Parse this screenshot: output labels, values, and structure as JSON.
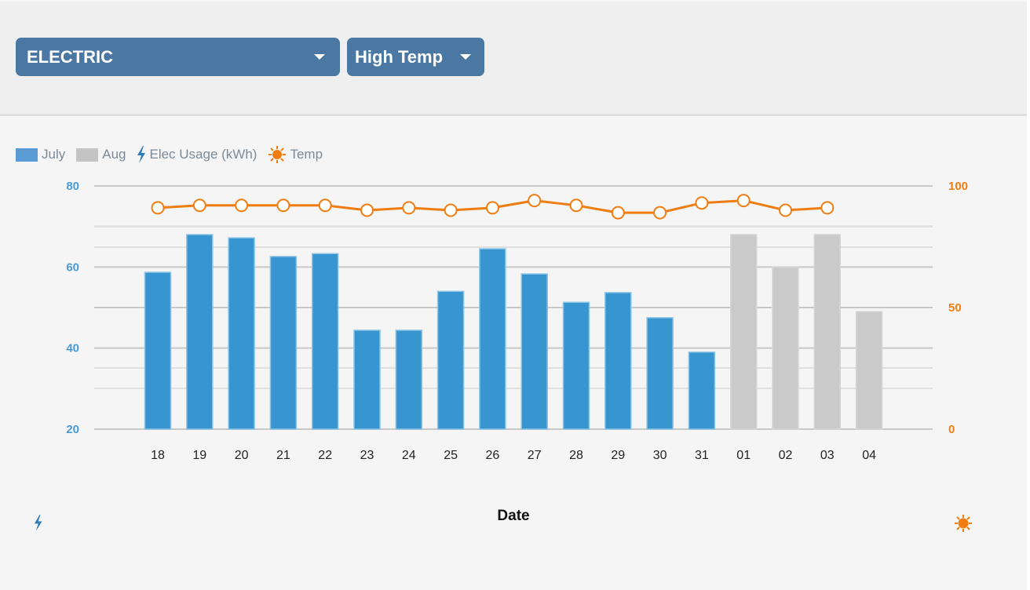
{
  "controls": {
    "utility_select": {
      "value": "ELECTRIC"
    },
    "metric_select": {
      "value": "High Temp"
    }
  },
  "legend": [
    {
      "label": "July",
      "kind": "swatch",
      "color": "#5b9bd5"
    },
    {
      "label": "Aug",
      "kind": "swatch",
      "color": "#c4c4c4"
    },
    {
      "label": "Elec Usage (kWh)",
      "kind": "bolt-icon",
      "color": "#2e7ab4"
    },
    {
      "label": "Temp",
      "kind": "sun-icon",
      "color": "#ef7d12"
    }
  ],
  "colors": {
    "july_bar": "#3796d0",
    "aug_bar": "#cacaca",
    "temp_line": "#ef7d12",
    "left_axis": "#4b9ad6",
    "right_axis": "#ef7d12",
    "grid_major": "#c8c8c8",
    "grid_minor": "#e0e0e0"
  },
  "chart_data": {
    "type": "bar",
    "title": "",
    "xlabel": "Date",
    "ylabel_left_icon": "bolt-icon",
    "ylabel_right_icon": "sun-icon",
    "categories": [
      "18",
      "19",
      "20",
      "21",
      "22",
      "23",
      "24",
      "25",
      "26",
      "27",
      "28",
      "29",
      "30",
      "31",
      "01",
      "02",
      "03",
      "04"
    ],
    "series": [
      {
        "name": "Elec Usage (kWh)",
        "type": "bar",
        "axis": "left",
        "month_groups": [
          "July",
          "July",
          "July",
          "July",
          "July",
          "July",
          "July",
          "July",
          "July",
          "July",
          "July",
          "July",
          "July",
          "July",
          "Aug",
          "Aug",
          "Aug",
          "Aug"
        ],
        "values": [
          58.7,
          68,
          67.2,
          62.6,
          63.3,
          44.4,
          44.4,
          54,
          64.5,
          58.3,
          51.3,
          53.7,
          47.5,
          39,
          68,
          60,
          68,
          49
        ]
      },
      {
        "name": "Temp",
        "type": "line",
        "axis": "right",
        "values": [
          91,
          92,
          92,
          92,
          92,
          90,
          91,
          90,
          91,
          94,
          92,
          89,
          89,
          93,
          94,
          90,
          91,
          null
        ]
      }
    ],
    "y_left": {
      "min": 20,
      "max": 80,
      "ticks": [
        20,
        40,
        60,
        80
      ]
    },
    "y_right": {
      "min": 0,
      "max": 100,
      "ticks": [
        0,
        50,
        100
      ]
    },
    "grid": true,
    "legend_position": "top-left"
  }
}
